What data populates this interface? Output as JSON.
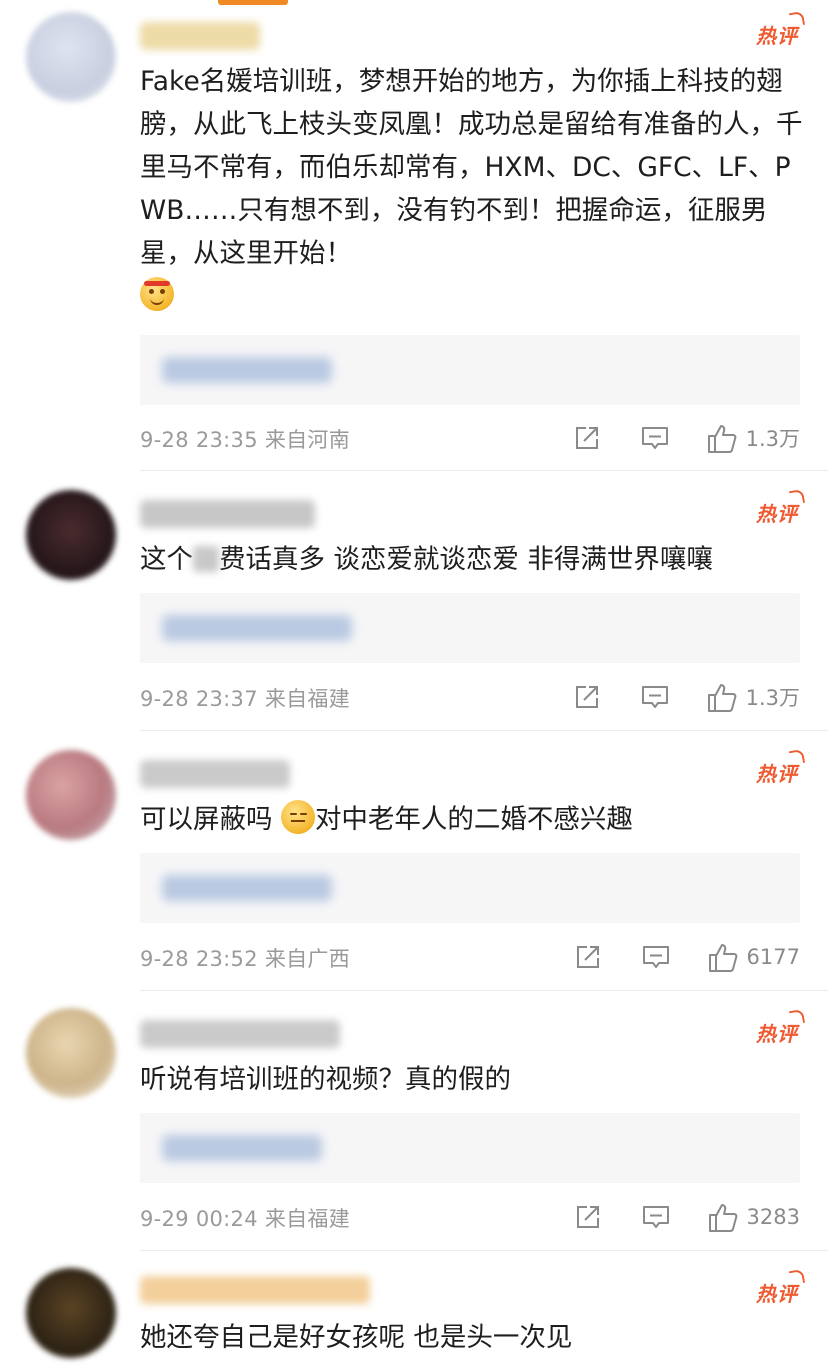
{
  "comments": [
    {
      "badge": "热评",
      "text_parts": [
        "Fake名媛培训班，梦想开始的地方，为你插上科技的翅膀，从此飞上枝头变凤凰！成功总是留给有准备的人，千里马不常有，而伯乐却常有，HXM、DC、GFC、LF、PWB……只有想不到，没有钓不到！把握命运，征服男星，从这里开始！"
      ],
      "meta": "9-28 23:35  来自河南",
      "likes": "1.3万"
    },
    {
      "badge": "热评",
      "text_parts": [
        "这个",
        "费话真多 谈恋爱就谈恋爱 非得满世界嚷嚷"
      ],
      "meta": "9-28 23:37  来自福建",
      "likes": "1.3万"
    },
    {
      "badge": "热评",
      "text_parts": [
        "可以屏蔽吗 ",
        "对中老年人的二婚不感兴趣"
      ],
      "meta": "9-28 23:52  来自广西",
      "likes": "6177"
    },
    {
      "badge": "热评",
      "text_parts": [
        "听说有培训班的视频？真的假的"
      ],
      "meta": "9-29 00:24  来自福建",
      "likes": "3283"
    },
    {
      "badge": "热评",
      "text_parts": [
        "她还夸自己是好女孩呢 也是头一次见"
      ],
      "meta": "",
      "likes": ""
    }
  ],
  "icons": {
    "share": "share-icon",
    "comment": "comment-icon",
    "like": "thumbs-up-icon"
  },
  "colors": {
    "hot_badge": "#ef5a31",
    "meta_text": "#9a9a9a",
    "reply_bg": "#f6f6f7",
    "tab_indicator": "#f08a24"
  }
}
